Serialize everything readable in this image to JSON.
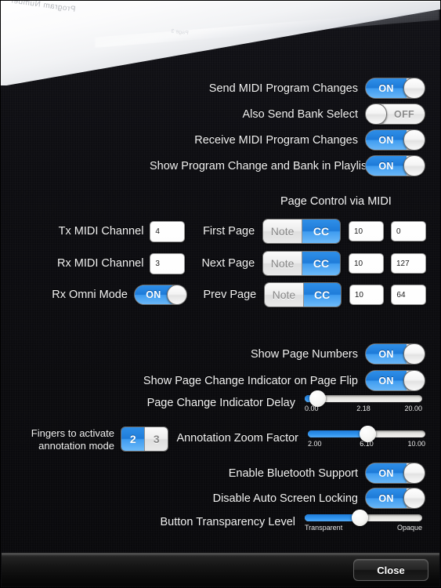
{
  "app": {
    "page_curl_text": "Program Number",
    "page_curl_text2": "Page 3"
  },
  "midi_section": {
    "rows": [
      {
        "label": "Send MIDI Program Changes",
        "state": "ON"
      },
      {
        "label": "Also Send Bank Select",
        "state": "OFF"
      },
      {
        "label": "Receive MIDI Program Changes",
        "state": "ON"
      },
      {
        "label": "Show Program Change and Bank in Playlists",
        "state": "ON"
      }
    ]
  },
  "page_control": {
    "title": "Page Control via MIDI",
    "channels": [
      {
        "label": "Tx MIDI Channel",
        "value": "4"
      },
      {
        "label": "Rx MIDI Channel",
        "value": "3"
      }
    ],
    "omni": {
      "label": "Rx Omni Mode",
      "state": "ON"
    },
    "page_rows": [
      {
        "label": "First Page",
        "seg_left": "Note",
        "seg_right": "CC",
        "selected": "CC",
        "num1": "10",
        "num2": "0"
      },
      {
        "label": "Next Page",
        "seg_left": "Note",
        "seg_right": "CC",
        "selected": "CC",
        "num1": "10",
        "num2": "127"
      },
      {
        "label": "Prev Page",
        "seg_left": "Note",
        "seg_right": "CC",
        "selected": "CC",
        "num1": "10",
        "num2": "64"
      }
    ]
  },
  "display_section": {
    "show_page_numbers": {
      "label": "Show Page Numbers",
      "state": "ON"
    },
    "show_indicator": {
      "label": "Show Page Change Indicator on Page Flip",
      "state": "ON"
    },
    "indicator_delay": {
      "label": "Page Change Indicator Delay",
      "min": "0.00",
      "value": "2.18",
      "max": "20.00",
      "percent": 11
    },
    "fingers": {
      "label_line1": "Fingers to activate",
      "label_line2": "annotation mode",
      "option_left": "2",
      "option_right": "3",
      "selected": "2"
    },
    "zoom_factor": {
      "label": "Annotation Zoom Factor",
      "min": "2.00",
      "value": "6.10",
      "max": "10.00",
      "percent": 51
    },
    "bluetooth": {
      "label": "Enable Bluetooth Support",
      "state": "ON"
    },
    "auto_lock": {
      "label": "Disable Auto Screen Locking",
      "state": "ON"
    },
    "transparency": {
      "label": "Button Transparency Level",
      "min": "Transparent",
      "max": "Opaque",
      "percent": 47
    }
  },
  "toolbar": {
    "close_label": "Close"
  },
  "colors": {
    "accent": "#2f8fe8",
    "background": "#0d0d11",
    "text": "#f2f2f2"
  }
}
